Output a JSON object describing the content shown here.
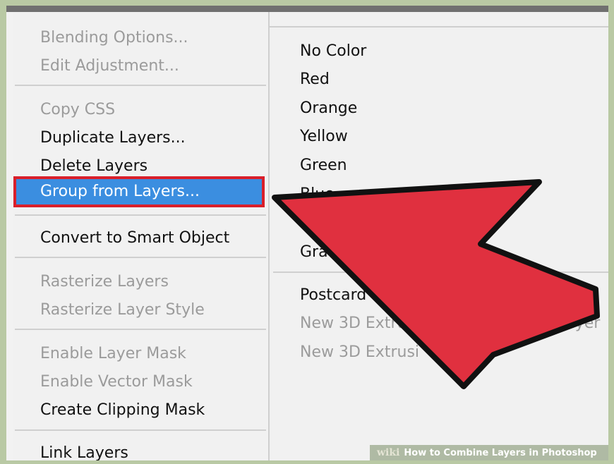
{
  "left_menu": {
    "group1": [
      "Blending Options...",
      "Edit Adjustment..."
    ],
    "group2": [
      "Copy CSS",
      "Duplicate Layers...",
      "Delete Layers"
    ],
    "highlighted": "Group from Layers...",
    "group3": [
      "Convert to Smart Object"
    ],
    "group4": [
      "Rasterize Layers",
      "Rasterize Layer Style"
    ],
    "group5": [
      "Enable Layer Mask",
      "Enable Vector Mask",
      "Create Clipping Mask"
    ],
    "group6": [
      "Link Layers"
    ]
  },
  "right_menu": {
    "colors": [
      "No Color",
      "Red",
      "Orange",
      "Yellow",
      "Green",
      "Blue",
      "Gra"
    ],
    "extras": [
      "Postcard",
      "New 3D Extrusion from Selected Layer",
      "New 3D Extrusi"
    ]
  },
  "annotation": {
    "highlight_color": "#d91f2a",
    "arrow_color": "#e0303f"
  },
  "watermark": {
    "brand": "wiki",
    "title": "How to Combine Layers in Photoshop"
  }
}
